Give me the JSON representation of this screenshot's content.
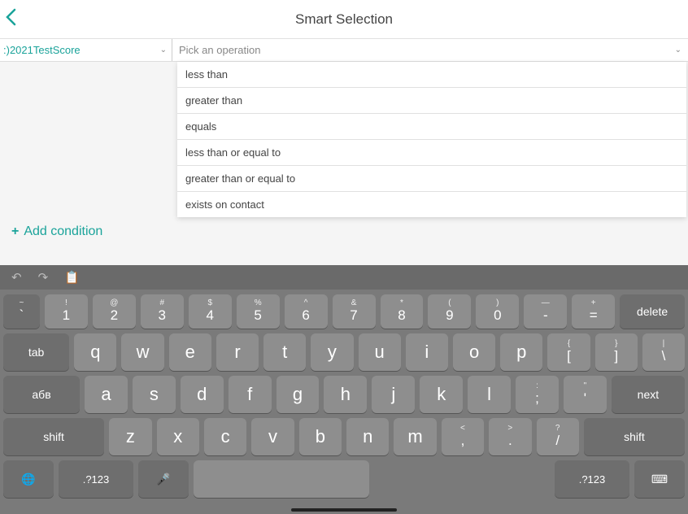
{
  "header": {
    "title": "Smart Selection"
  },
  "form": {
    "field_value": ":)2021TestScore",
    "operation_placeholder": "Pick an operation"
  },
  "dropdown": {
    "items": [
      "less than",
      "greater than",
      "equals",
      "less than or equal to",
      "greater than or equal to",
      "exists on contact"
    ]
  },
  "actions": {
    "add_condition": "Add condition"
  },
  "keyboard": {
    "row1": [
      {
        "sup": "~",
        "main": "`"
      },
      {
        "sup": "!",
        "main": "1"
      },
      {
        "sup": "@",
        "main": "2"
      },
      {
        "sup": "#",
        "main": "3"
      },
      {
        "sup": "$",
        "main": "4"
      },
      {
        "sup": "%",
        "main": "5"
      },
      {
        "sup": "^",
        "main": "6"
      },
      {
        "sup": "&",
        "main": "7"
      },
      {
        "sup": "*",
        "main": "8"
      },
      {
        "sup": "(",
        "main": "9"
      },
      {
        "sup": ")",
        "main": "0"
      },
      {
        "sup": "—",
        "main": "-"
      },
      {
        "sup": "+",
        "main": "="
      }
    ],
    "delete": "delete",
    "tab": "tab",
    "row2": [
      "q",
      "w",
      "e",
      "r",
      "t",
      "y",
      "u",
      "i",
      "o",
      "p"
    ],
    "row2b": [
      {
        "sup": "{",
        "main": "["
      },
      {
        "sup": "}",
        "main": "]"
      },
      {
        "sup": "|",
        "main": "\\"
      }
    ],
    "abv": "абв",
    "row3": [
      "a",
      "s",
      "d",
      "f",
      "g",
      "h",
      "j",
      "k",
      "l"
    ],
    "row3b": [
      {
        "sup": ":",
        "main": ";"
      },
      {
        "sup": "\"",
        "main": "'"
      }
    ],
    "next": "next",
    "shift": "shift",
    "row4": [
      "z",
      "x",
      "c",
      "v",
      "b",
      "n",
      "m"
    ],
    "row4b": [
      {
        "sup": "<",
        "main": ","
      },
      {
        "sup": ">",
        "main": "."
      },
      {
        "sup": "?",
        "main": "/"
      }
    ],
    "num": ".?123"
  }
}
